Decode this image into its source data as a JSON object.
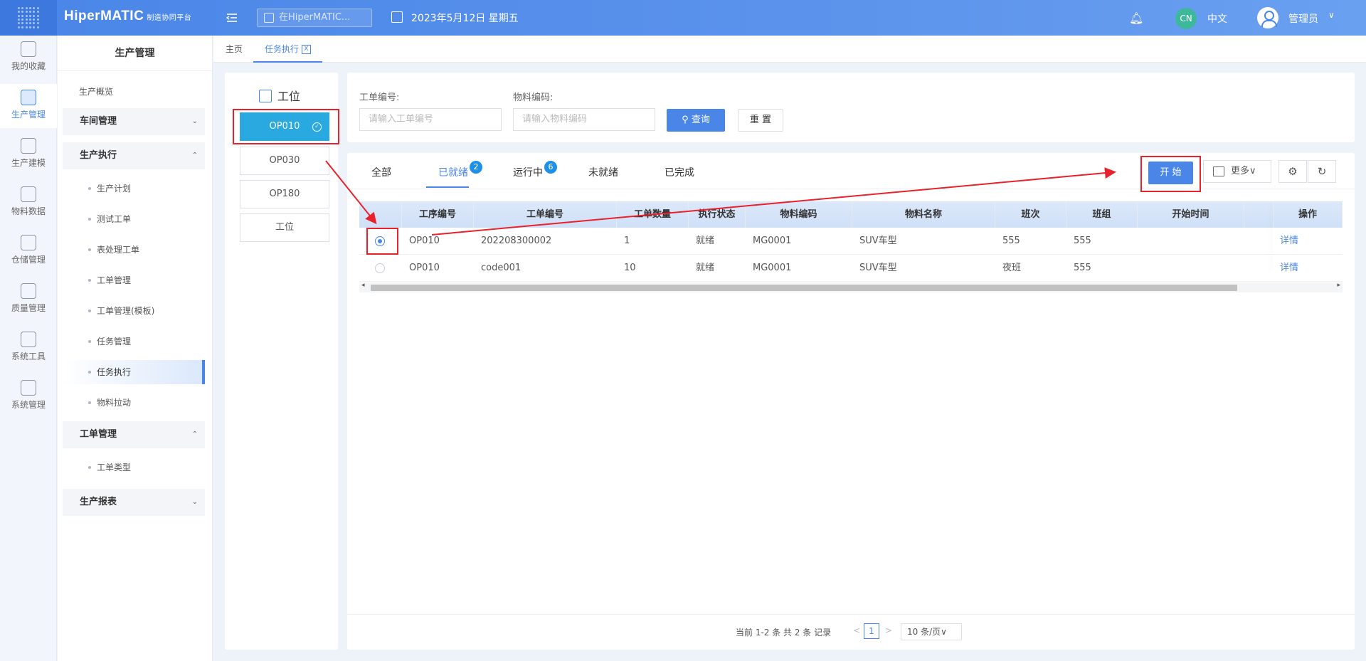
{
  "header": {
    "brand": "HiperMATIC",
    "brand_sub": "制造协同平台",
    "search_placeholder": "在HiperMATIC...",
    "date": "2023年5月12日 星期五",
    "lang_badge": "CN",
    "lang": "中文",
    "user": "管理员"
  },
  "rail": [
    {
      "label": "我的收藏",
      "icon": "star-icon"
    },
    {
      "label": "生产管理",
      "icon": "production-icon"
    },
    {
      "label": "生产建模",
      "icon": "cube-icon"
    },
    {
      "label": "物料数据",
      "icon": "material-icon"
    },
    {
      "label": "仓储管理",
      "icon": "warehouse-icon"
    },
    {
      "label": "质量管理",
      "icon": "quality-icon"
    },
    {
      "label": "系统工具",
      "icon": "network-icon"
    },
    {
      "label": "系统管理",
      "icon": "settings-cube-icon"
    }
  ],
  "sidebar": {
    "title": "生产管理",
    "overview": "生产概览",
    "groups": [
      {
        "label": "车间管理"
      },
      {
        "label": "生产执行"
      },
      {
        "label": "工单管理"
      },
      {
        "label": "生产报表"
      }
    ],
    "exec_items": [
      "生产计划",
      "测试工单",
      "表处理工单",
      "工单管理",
      "工单管理(模板)",
      "任务管理",
      "任务执行",
      "物料拉动"
    ],
    "wo_items": [
      "工单类型"
    ]
  },
  "page_tabs": {
    "home": "主页",
    "current": "任务执行",
    "close": "X"
  },
  "workstation": {
    "title": "工位",
    "items": [
      "OP010",
      "OP030",
      "OP180",
      "工位"
    ]
  },
  "filter": {
    "wo_label": "工单编号:",
    "wo_placeholder": "请输入工单编号",
    "mat_label": "物料编码:",
    "mat_placeholder": "请输入物料编码",
    "query": "查询",
    "reset": "重 置"
  },
  "status_tabs": [
    {
      "label": "全部"
    },
    {
      "label": "已就绪",
      "badge": "2"
    },
    {
      "label": "运行中",
      "badge": "6"
    },
    {
      "label": "未就绪"
    },
    {
      "label": "已完成"
    }
  ],
  "toolbar": {
    "start": "开 始",
    "more": "更多∨"
  },
  "table": {
    "columns": [
      "工序编号",
      "工单编号",
      "工单数量",
      "执行状态",
      "物料编码",
      "物料名称",
      "班次",
      "班组",
      "开始时间",
      "操作"
    ],
    "rows": [
      {
        "op": "OP010",
        "wo": "202208300002",
        "qty": "1",
        "status": "就绪",
        "mat_code": "MG0001",
        "mat_name": "SUV车型",
        "shift": "555",
        "team": "555",
        "start": "",
        "action": "详情",
        "selected": true
      },
      {
        "op": "OP010",
        "wo": "code001",
        "qty": "10",
        "status": "就绪",
        "mat_code": "MG0001",
        "mat_name": "SUV车型",
        "shift": "夜班",
        "team": "555",
        "start": "",
        "action": "详情",
        "selected": false
      }
    ]
  },
  "pager": {
    "summary": "当前 1-2 条 共 2 条 记录",
    "page": "1",
    "size": "10 条/页∨"
  },
  "colors": {
    "primary": "#4a86e8",
    "active_station": "#29a9e0",
    "annotation": "#e8212a"
  }
}
